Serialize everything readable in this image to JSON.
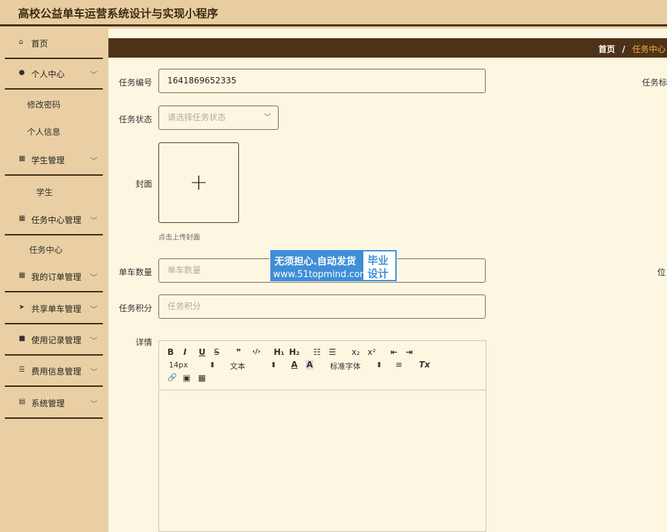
{
  "app": {
    "title": "高校公益单车运营系统设计与实现小程序"
  },
  "sidebar": {
    "items": [
      {
        "label": "首页",
        "icon": "home-icon",
        "glyph": "⌂"
      },
      {
        "label": "个人中心",
        "icon": "user-icon",
        "glyph": "●",
        "chevron": "﹀"
      },
      {
        "label": "学生管理",
        "icon": "grid-icon",
        "glyph": "▦",
        "chevron": "﹀"
      },
      {
        "label": "任务中心管理",
        "icon": "grid-icon",
        "glyph": "▦",
        "chevron": "﹀"
      },
      {
        "label": "我的订单管理",
        "icon": "grid-icon",
        "glyph": "▦",
        "chevron": "﹀"
      },
      {
        "label": "共享单车管理",
        "icon": "send-icon",
        "glyph": "➤",
        "chevron": "﹀"
      },
      {
        "label": "使用记录管理",
        "icon": "briefcase-icon",
        "glyph": "■",
        "chevron": "﹀"
      },
      {
        "label": "费用信息管理",
        "icon": "sliders-icon",
        "glyph": "☰",
        "chevron": "﹀"
      },
      {
        "label": "系统管理",
        "icon": "doc-icon",
        "glyph": "▤",
        "chevron": "﹀"
      }
    ],
    "sub": {
      "change_password": "修改密码",
      "personal_info": "个人信息",
      "student": "学生",
      "task_center": "任务中心"
    }
  },
  "breadcrumb": {
    "home": "首页",
    "sep": "/",
    "current": "任务中心"
  },
  "form": {
    "task_no": {
      "label": "任务编号",
      "value": "1641869652335"
    },
    "task_status": {
      "label": "任务状态",
      "placeholder": "请选择任务状态"
    },
    "cover": {
      "label": "封面",
      "hint": "点击上传封面"
    },
    "bike_count": {
      "label": "单车数量",
      "placeholder": "单车数量"
    },
    "task_points": {
      "label": "任务积分",
      "placeholder": "任务积分"
    },
    "detail": {
      "label": "详情"
    },
    "right_label_1": "任务标",
    "right_label_2": "位"
  },
  "editor": {
    "font_size": "14px",
    "text_style": "文本",
    "font_family": "标准字体",
    "buttons": {
      "bold": "B",
      "italic": "I",
      "underline": "U",
      "strike": "S",
      "quote": "❞",
      "code": "‹/›",
      "h1": "H₁",
      "h2": "H₂",
      "ol": "☷",
      "ul": "☰",
      "sub": "x₂",
      "sup": "x²",
      "outdent": "⇤",
      "indent": "⇥",
      "color": "A",
      "bg": "A",
      "align": "≡",
      "clear": "Tx",
      "link": "🔗",
      "image": "▣",
      "video": "▦",
      "select_arrow": "⬍"
    }
  },
  "watermark": {
    "line1": "无须担心.自动发货",
    "line2": "www.51topmind.com",
    "box1": "毕业",
    "box2": "设计"
  }
}
